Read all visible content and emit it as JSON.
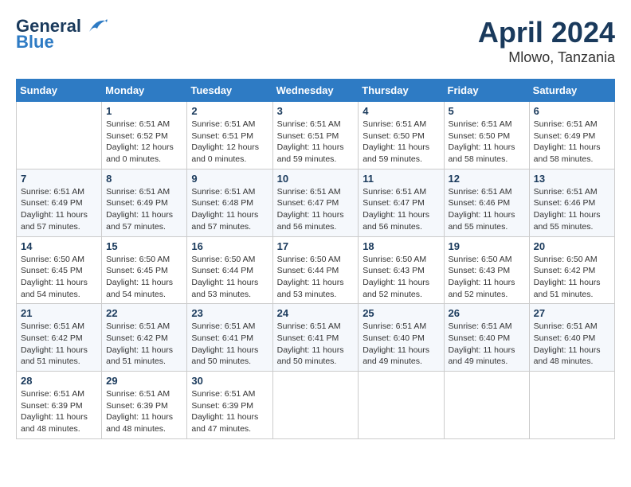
{
  "header": {
    "logo_general": "General",
    "logo_blue": "Blue",
    "title": "April 2024",
    "location": "Mlowo, Tanzania"
  },
  "weekdays": [
    "Sunday",
    "Monday",
    "Tuesday",
    "Wednesday",
    "Thursday",
    "Friday",
    "Saturday"
  ],
  "weeks": [
    [
      {
        "day": "",
        "info": ""
      },
      {
        "day": "1",
        "info": "Sunrise: 6:51 AM\nSunset: 6:52 PM\nDaylight: 12 hours\nand 0 minutes."
      },
      {
        "day": "2",
        "info": "Sunrise: 6:51 AM\nSunset: 6:51 PM\nDaylight: 12 hours\nand 0 minutes."
      },
      {
        "day": "3",
        "info": "Sunrise: 6:51 AM\nSunset: 6:51 PM\nDaylight: 11 hours\nand 59 minutes."
      },
      {
        "day": "4",
        "info": "Sunrise: 6:51 AM\nSunset: 6:50 PM\nDaylight: 11 hours\nand 59 minutes."
      },
      {
        "day": "5",
        "info": "Sunrise: 6:51 AM\nSunset: 6:50 PM\nDaylight: 11 hours\nand 58 minutes."
      },
      {
        "day": "6",
        "info": "Sunrise: 6:51 AM\nSunset: 6:49 PM\nDaylight: 11 hours\nand 58 minutes."
      }
    ],
    [
      {
        "day": "7",
        "info": ""
      },
      {
        "day": "8",
        "info": "Sunrise: 6:51 AM\nSunset: 6:49 PM\nDaylight: 11 hours\nand 57 minutes."
      },
      {
        "day": "9",
        "info": "Sunrise: 6:51 AM\nSunset: 6:48 PM\nDaylight: 11 hours\nand 57 minutes."
      },
      {
        "day": "10",
        "info": "Sunrise: 6:51 AM\nSunset: 6:47 PM\nDaylight: 11 hours\nand 56 minutes."
      },
      {
        "day": "11",
        "info": "Sunrise: 6:51 AM\nSunset: 6:47 PM\nDaylight: 11 hours\nand 56 minutes."
      },
      {
        "day": "12",
        "info": "Sunrise: 6:51 AM\nSunset: 6:46 PM\nDaylight: 11 hours\nand 55 minutes."
      },
      {
        "day": "13",
        "info": "Sunrise: 6:51 AM\nSunset: 6:46 PM\nDaylight: 11 hours\nand 55 minutes."
      }
    ],
    [
      {
        "day": "14",
        "info": ""
      },
      {
        "day": "15",
        "info": "Sunrise: 6:50 AM\nSunset: 6:45 PM\nDaylight: 11 hours\nand 54 minutes."
      },
      {
        "day": "16",
        "info": "Sunrise: 6:50 AM\nSunset: 6:44 PM\nDaylight: 11 hours\nand 53 minutes."
      },
      {
        "day": "17",
        "info": "Sunrise: 6:50 AM\nSunset: 6:44 PM\nDaylight: 11 hours\nand 53 minutes."
      },
      {
        "day": "18",
        "info": "Sunrise: 6:50 AM\nSunset: 6:43 PM\nDaylight: 11 hours\nand 52 minutes."
      },
      {
        "day": "19",
        "info": "Sunrise: 6:50 AM\nSunset: 6:43 PM\nDaylight: 11 hours\nand 52 minutes."
      },
      {
        "day": "20",
        "info": "Sunrise: 6:50 AM\nSunset: 6:42 PM\nDaylight: 11 hours\nand 51 minutes."
      }
    ],
    [
      {
        "day": "21",
        "info": ""
      },
      {
        "day": "22",
        "info": "Sunrise: 6:51 AM\nSunset: 6:42 PM\nDaylight: 11 hours\nand 51 minutes."
      },
      {
        "day": "23",
        "info": "Sunrise: 6:51 AM\nSunset: 6:41 PM\nDaylight: 11 hours\nand 50 minutes."
      },
      {
        "day": "24",
        "info": "Sunrise: 6:51 AM\nSunset: 6:41 PM\nDaylight: 11 hours\nand 50 minutes."
      },
      {
        "day": "25",
        "info": "Sunrise: 6:51 AM\nSunset: 6:40 PM\nDaylight: 11 hours\nand 49 minutes."
      },
      {
        "day": "26",
        "info": "Sunrise: 6:51 AM\nSunset: 6:40 PM\nDaylight: 11 hours\nand 49 minutes."
      },
      {
        "day": "27",
        "info": "Sunrise: 6:51 AM\nSunset: 6:40 PM\nDaylight: 11 hours\nand 48 minutes."
      }
    ],
    [
      {
        "day": "28",
        "info": "Sunrise: 6:51 AM\nSunset: 6:39 PM\nDaylight: 11 hours\nand 48 minutes."
      },
      {
        "day": "29",
        "info": "Sunrise: 6:51 AM\nSunset: 6:39 PM\nDaylight: 11 hours\nand 48 minutes."
      },
      {
        "day": "30",
        "info": "Sunrise: 6:51 AM\nSunset: 6:39 PM\nDaylight: 11 hours\nand 47 minutes."
      },
      {
        "day": "",
        "info": ""
      },
      {
        "day": "",
        "info": ""
      },
      {
        "day": "",
        "info": ""
      },
      {
        "day": "",
        "info": ""
      }
    ]
  ],
  "week1_day7_info": "Sunrise: 6:51 AM\nSunset: 6:49 PM\nDaylight: 11 hours\nand 57 minutes.",
  "week3_day14_info": "Sunrise: 6:50 AM\nSunset: 6:45 PM\nDaylight: 11 hours\nand 54 minutes.",
  "week4_day21_info": "Sunrise: 6:51 AM\nSunset: 6:42 PM\nDaylight: 11 hours\nand 51 minutes."
}
